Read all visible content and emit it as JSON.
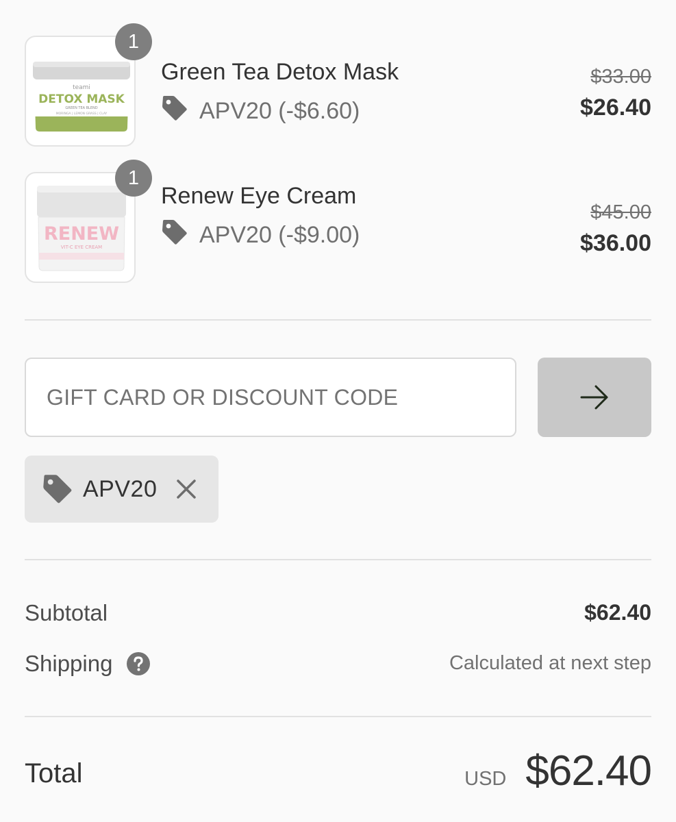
{
  "products": [
    {
      "name": "Green Tea Detox Mask",
      "quantity": "1",
      "discount": "APV20 (-$6.60)",
      "original_price": "$33.00",
      "price": "$26.40",
      "image_icon": "detox-mask-jar-image",
      "image_text": {
        "brand": "teami",
        "title": "DETOX MASK",
        "sub": "GREEN TEA BLEND",
        "sub2": "MORINGA | LEMON GRASS | CLAY"
      }
    },
    {
      "name": "Renew Eye Cream",
      "quantity": "1",
      "discount": "APV20 (-$9.00)",
      "original_price": "$45.00",
      "price": "$36.00",
      "image_icon": "renew-eye-cream-jar-image",
      "image_text": {
        "title": "RENEW",
        "sub": "VIT-C EYE CREAM"
      }
    }
  ],
  "discount_form": {
    "placeholder": "GIFT CARD OR DISCOUNT CODE",
    "value": "",
    "apply_icon": "arrow-right-icon"
  },
  "applied_code": {
    "label": "APV20",
    "tag_icon": "tag-icon",
    "remove_icon": "close-icon"
  },
  "summary": {
    "subtotal_label": "Subtotal",
    "subtotal_value": "$62.40",
    "shipping_label": "Shipping",
    "shipping_help_icon": "question-circle-icon",
    "shipping_value": "Calculated at next step",
    "total_label": "Total",
    "total_currency": "USD",
    "total_value": "$62.40"
  },
  "colors": {
    "background": "#fafafa",
    "text": "#333333",
    "muted": "#717171",
    "badge": "#7f7f7f",
    "apply_button": "#c8c8c8",
    "chip": "#e6e6e6",
    "mask_green": "#9bb45a"
  }
}
